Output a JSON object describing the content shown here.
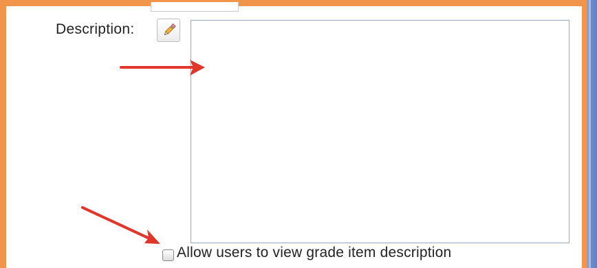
{
  "form": {
    "description_label": "Description:",
    "description_value": "",
    "edit_button_icon": "pencil-icon",
    "allow_view_label": "Allow users to view grade item description",
    "allow_view_checked": false
  },
  "colors": {
    "frame_border": "#f0954a",
    "annotation_arrow": "#e0362b",
    "scrollbar": "#6f8dd0"
  }
}
